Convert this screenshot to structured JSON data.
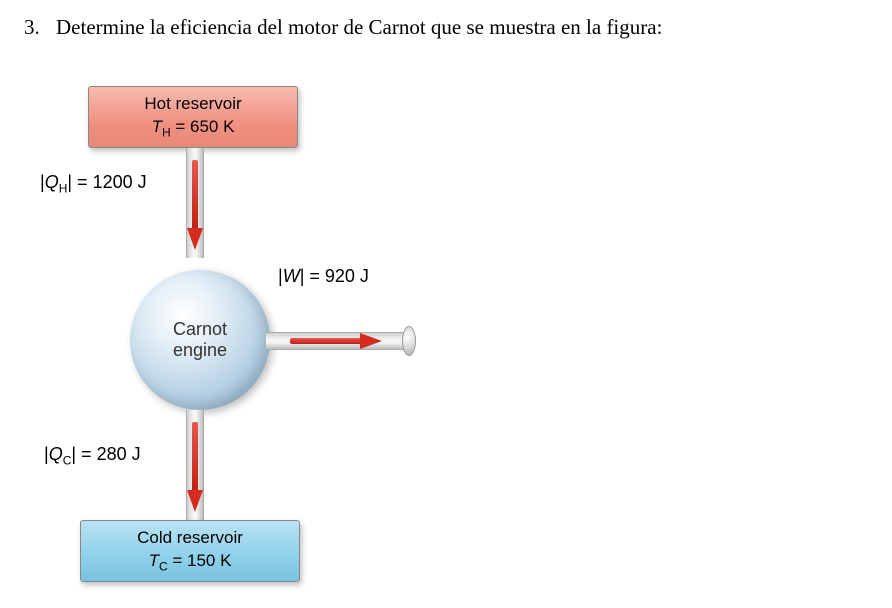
{
  "question": {
    "number": "3.",
    "text": "Determine la eficiencia del motor de Carnot que se muestra en la figura:"
  },
  "diagram": {
    "hot_reservoir": {
      "title": "Hot reservoir",
      "temp": "TH = 650 K",
      "temp_sym": "T",
      "temp_sub": "H",
      "temp_val": " = 650 K"
    },
    "cold_reservoir": {
      "title": "Cold reservoir",
      "temp_sym": "T",
      "temp_sub": "C",
      "temp_val": " = 150 K"
    },
    "engine": {
      "line1": "Carnot",
      "line2": "engine"
    },
    "qh": {
      "sym": "Q",
      "sub": "H",
      "val": "| = 1200 J",
      "pre": "|"
    },
    "qc": {
      "sym": "Q",
      "sub": "C",
      "val": "| = 280 J",
      "pre": "|"
    },
    "w": {
      "sym": "W",
      "val": "| = 920 J",
      "pre": "|"
    }
  },
  "chart_data": {
    "type": "diagram",
    "description": "Carnot heat engine energy flow",
    "hot_temperature_K": 650,
    "cold_temperature_K": 150,
    "heat_in_J": 1200,
    "work_out_J": 920,
    "heat_rejected_J": 280
  }
}
